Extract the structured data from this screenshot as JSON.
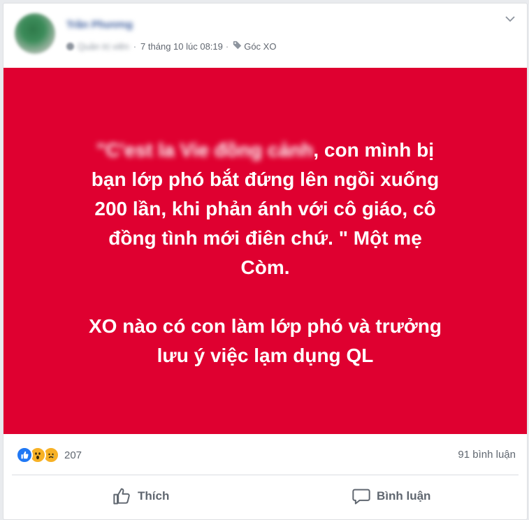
{
  "post": {
    "author_name": "Trần Phương",
    "author_role": "Quản trị viên",
    "timestamp": "7 tháng 10 lúc 08:19",
    "group_name": "Góc XO",
    "text_blurred": "\"C'est la Vie đồng cảnh",
    "text_line1_rest": ", con mình bị",
    "text_line2": "bạn lớp phó bắt đứng lên ngồi xuống",
    "text_line3": "200 lần, khi phản ánh với cô giáo, cô",
    "text_line4": "đồng tình mới điên chứ. \" Một mẹ",
    "text_line5": "Còm.",
    "text_line6": "XO nào có con làm lớp phó và trưởng",
    "text_line7": "lưu ý việc lạm dụng QL",
    "background_color": "#df0030"
  },
  "engagement": {
    "reaction_count": "207",
    "comment_count": "91 bình luận",
    "reaction_icons": [
      "like-icon",
      "wow-icon",
      "sad-icon"
    ]
  },
  "actions": {
    "like_label": "Thích",
    "comment_label": "Bình luận"
  }
}
